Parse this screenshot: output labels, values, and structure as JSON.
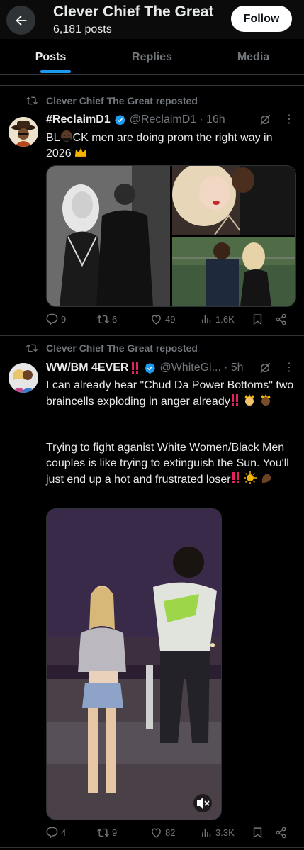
{
  "header": {
    "title": "Clever Chief The Great",
    "posts_count": "6,181 posts",
    "follow_label": "Follow"
  },
  "tabs": [
    "Posts",
    "Replies",
    "Media"
  ],
  "posts": [
    {
      "repost_label": "Clever Chief The Great reposted",
      "name": "#ReclaimD1",
      "handle": "@ReclaimD1",
      "time": "· 16h",
      "text_parts": [
        "BL",
        "CK men are doing prom the right way in 2026"
      ],
      "replies": "9",
      "reposts": "6",
      "likes": "49",
      "views": "1.6K"
    },
    {
      "repost_label": "Clever Chief The Great reposted",
      "name": "WW/BM 4EVER",
      "handle": "@WhiteGi...",
      "time": "· 5h",
      "text_p1": "I can already hear \"Chud Da Power Bottoms\" two braincells exploding in anger already",
      "text_p2": "Trying to fight aganist White Women/Black Men couples is like trying to extinguish the Sun. You'll just end up a hot and frustrated loser",
      "replies": "4",
      "reposts": "9",
      "likes": "82",
      "views": "3.3K"
    }
  ],
  "colors": {
    "accent": "#1d9bf0",
    "muted": "#71767b",
    "verified": "#1d9bf0",
    "alert": "#e0245e"
  }
}
